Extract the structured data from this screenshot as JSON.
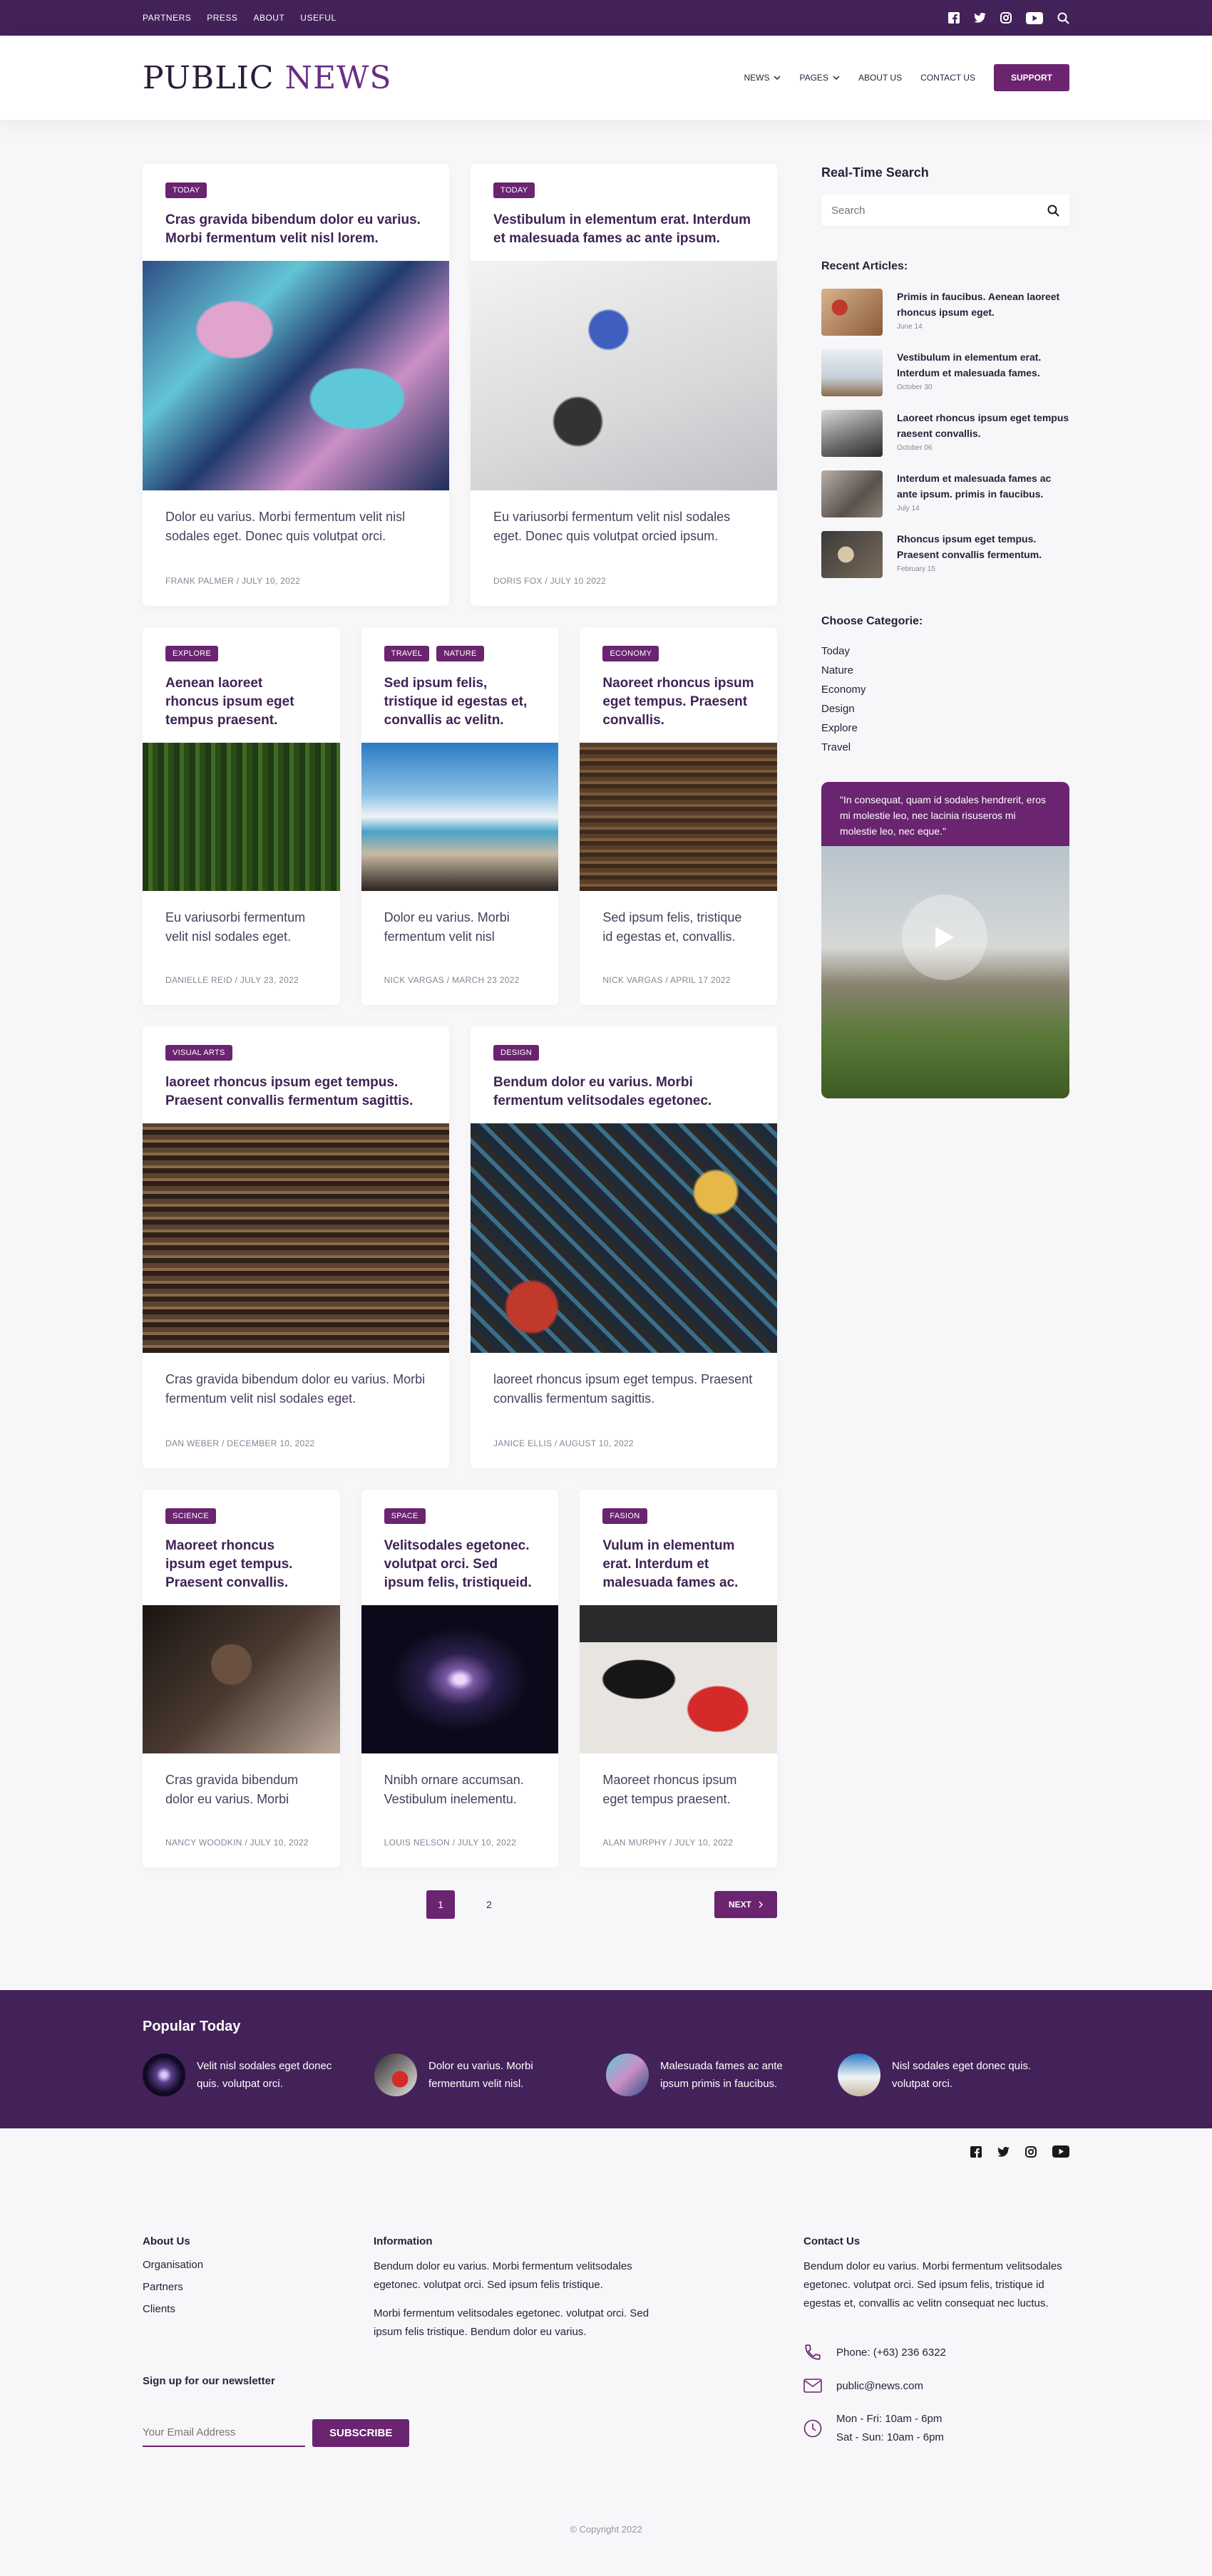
{
  "topbar": {
    "links": [
      "PARTNERS",
      "PRESS",
      "ABOUT",
      "USEFUL"
    ],
    "icons": [
      "facebook-icon",
      "twitter-icon",
      "instagram-icon",
      "youtube-icon",
      "search-icon"
    ]
  },
  "header": {
    "logo_part1": "PUBLIC ",
    "logo_part2": "NEWS",
    "nav": [
      "NEWS",
      "PAGES",
      "ABOUT US",
      "CONTACT US"
    ],
    "support_label": "SUPPORT"
  },
  "articles": [
    {
      "tags": [
        "TODAY"
      ],
      "title": "Cras gravida bibendum dolor eu varius. Morbi fermentum velit nisl lorem.",
      "excerpt": "Dolor eu varius. Morbi fermentum velit nisl sodales eget. Donec quis volutpat orci.",
      "meta": "FRANK PALMER / JULY 10, 2022"
    },
    {
      "tags": [
        "TODAY"
      ],
      "title": "Vestibulum in elementum erat. Interdum et malesuada fames ac ante ipsum.",
      "excerpt": "Eu variusorbi fermentum velit nisl sodales eget. Donec quis volutpat orcied ipsum.",
      "meta": "DORIS FOX / JULY 10 2022"
    },
    {
      "tags": [
        "EXPLORE"
      ],
      "title": "Aenean laoreet rhoncus ipsum eget tempus praesent.",
      "excerpt": "Eu variusorbi fermentum velit nisl sodales eget.",
      "meta": "DANIELLE REID / JULY 23, 2022"
    },
    {
      "tags": [
        "TRAVEL",
        "NATURE"
      ],
      "title": "Sed ipsum felis, tristique id egestas et, convallis ac velitn.",
      "excerpt": "Dolor eu varius. Morbi fermentum velit nisl",
      "meta": "NICK VARGAS / MARCH 23 2022"
    },
    {
      "tags": [
        "ECONOMY"
      ],
      "title": "Naoreet rhoncus ipsum eget tempus. Praesent convallis.",
      "excerpt": "Sed ipsum felis, tristique id egestas et, convallis.",
      "meta": "NICK VARGAS / APRIL 17 2022"
    },
    {
      "tags": [
        "VISUAL ARTS"
      ],
      "title": "laoreet rhoncus ipsum eget tempus. Praesent convallis fermentum sagittis.",
      "excerpt": "Cras gravida bibendum dolor eu varius. Morbi fermentum velit nisl sodales eget.",
      "meta": "DAN WEBER / DECEMBER 10, 2022"
    },
    {
      "tags": [
        "DESIGN"
      ],
      "title": "Bendum dolor eu varius. Morbi fermentum velitsodales egetonec.",
      "excerpt": "laoreet rhoncus ipsum eget tempus. Praesent convallis fermentum sagittis.",
      "meta": "JANICE ELLIS / AUGUST 10, 2022"
    },
    {
      "tags": [
        "SCIENCE"
      ],
      "title": "Maoreet rhoncus ipsum eget tempus. Praesent convallis.",
      "excerpt": "Cras gravida bibendum dolor eu varius. Morbi",
      "meta": "NANCY WOODKIN / JULY 10, 2022"
    },
    {
      "tags": [
        "SPACE"
      ],
      "title": "Velitsodales egetonec. volutpat orci. Sed ipsum felis, tristiqueid.",
      "excerpt": "Nnibh ornare accumsan. Vestibulum inelementu.",
      "meta": "LOUIS NELSON / JULY 10, 2022"
    },
    {
      "tags": [
        "FASION"
      ],
      "title": "Vulum in elementum erat. Interdum et malesuada fames ac.",
      "excerpt": "Maoreet rhoncus ipsum eget tempus praesent.",
      "meta": "ALAN MURPHY / JULY 10, 2022"
    }
  ],
  "pagination": {
    "pages": [
      "1",
      "2"
    ],
    "active": "1",
    "next_label": "NEXT"
  },
  "sidebar": {
    "search_title": "Real-Time Search",
    "search_placeholder": "Search",
    "recent_title": "Recent Articles:",
    "recent": [
      {
        "title": "Primis in faucibus. Aenean laoreet rhoncus ipsum eget.",
        "date": "June 14"
      },
      {
        "title": "Vestibulum in elementum erat. Interdum et malesuada fames.",
        "date": "October 30"
      },
      {
        "title": "Laoreet rhoncus ipsum eget tempus raesent convallis.",
        "date": "October 06"
      },
      {
        "title": "Interdum et malesuada fames ac ante ipsum. primis in faucibus.",
        "date": "July 14"
      },
      {
        "title": "Rhoncus ipsum eget tempus. Praesent convallis fermentum.",
        "date": "February 15"
      }
    ],
    "categories_title": "Choose Categorie:",
    "categories": [
      "Today",
      "Nature",
      "Economy",
      "Design",
      "Explore",
      "Travel"
    ],
    "video_quote": "\"In consequat, quam id sodales hendrerit, eros mi molestie leo, nec lacinia risuseros mi molestie leo, nec eque.\""
  },
  "popular": {
    "title": "Popular Today",
    "items": [
      "Velit nisl sodales eget donec quis. volutpat orci.",
      "Dolor eu varius. Morbi fermentum velit nisl.",
      "Malesuada fames ac ante ipsum primis in faucibus.",
      "Nisl sodales eget donec quis. volutpat orci."
    ]
  },
  "footer": {
    "about_title": "About Us",
    "about_links": [
      "Organisation",
      "Partners",
      "Clients"
    ],
    "info_title": "Information",
    "info_p1": "Bendum dolor eu varius. Morbi fermentum velitsodales egetonec. volutpat orci. Sed ipsum felis tristique.",
    "info_p2": "Morbi fermentum velitsodales egetonec. volutpat orci. Sed ipsum felis tristique. Bendum dolor eu varius.",
    "contact_title": "Contact Us",
    "contact_text": "Bendum dolor eu varius. Morbi fermentum velitsodales egetonec. volutpat orci. Sed ipsum felis, tristique id egestas et, convallis ac velitn consequat nec luctus.",
    "phone": "Phone: (+63) 236 6322",
    "email": "public@news.com",
    "hours1": "Mon - Fri: 10am - 6pm",
    "hours2": "Sat - Sun: 10am - 6pm",
    "newsletter_title": "Sign up for our newsletter",
    "email_placeholder": "Your Email Address",
    "subscribe_label": "SUBSCRIBE",
    "copyright": "© Copyright 2022"
  },
  "colors": {
    "brand": "#43225a",
    "accent": "#6a2470"
  }
}
